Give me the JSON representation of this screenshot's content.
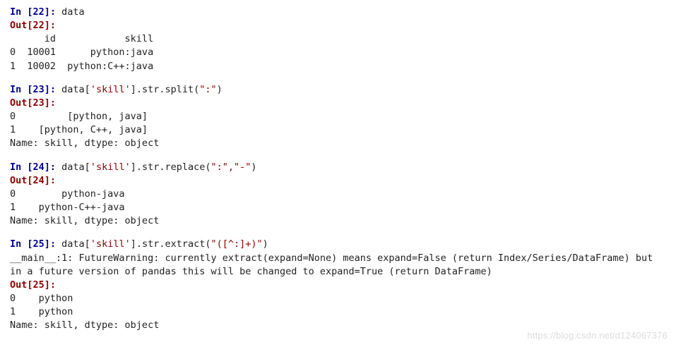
{
  "cells": [
    {
      "in_num": "22",
      "code_plain": "data",
      "code_prefix": "",
      "code_str": "",
      "code_mid": "",
      "code_str2": "",
      "code_suffix": "",
      "out_num": "22",
      "warning": "",
      "output": "      id            skill\n0  10001      python:java\n1  10002  python:C++:java"
    },
    {
      "in_num": "23",
      "code_plain": "",
      "code_prefix": "data[",
      "code_str": "'skill'",
      "code_mid": "].str.split(",
      "code_str2": "\":\"",
      "code_suffix": ")",
      "out_num": "23",
      "warning": "",
      "output": "0         [python, java]\n1    [python, C++, java]\nName: skill, dtype: object"
    },
    {
      "in_num": "24",
      "code_plain": "",
      "code_prefix": "data[",
      "code_str": "'skill'",
      "code_mid": "].str.replace(",
      "code_str2": "\":\",\"-\"",
      "code_suffix": ")",
      "out_num": "24",
      "warning": "",
      "output": "0        python-java\n1    python-C++-java\nName: skill, dtype: object"
    },
    {
      "in_num": "25",
      "code_plain": "",
      "code_prefix": "data[",
      "code_str": "'skill'",
      "code_mid": "].str.extract(",
      "code_str2": "\"([^:]+)\"",
      "code_suffix": ")",
      "out_num": "25",
      "warning": "__main__:1: FutureWarning: currently extract(expand=None) means expand=False (return Index/Series/DataFrame) but in a future version of pandas this will be changed to expand=True (return DataFrame)",
      "output": "0    python\n1    python\nName: skill, dtype: object"
    }
  ],
  "watermark": "https://blog.csdn.net/d124067376"
}
